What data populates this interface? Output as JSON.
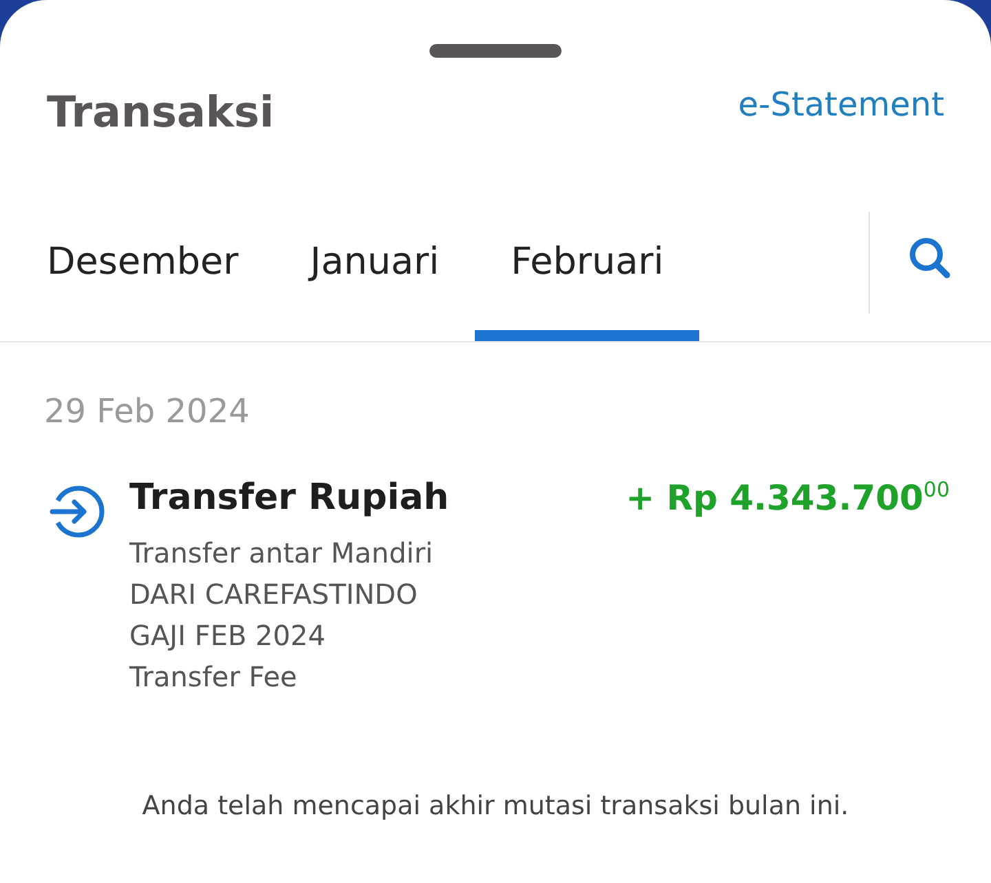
{
  "header": {
    "title": "Transaksi",
    "link": "e-Statement"
  },
  "tabs": [
    {
      "label": "Desember",
      "selected": false
    },
    {
      "label": "Januari",
      "selected": false
    },
    {
      "label": "Februari",
      "selected": true
    }
  ],
  "groups": [
    {
      "date": "29 Feb 2024",
      "transactions": [
        {
          "kind": "incoming",
          "title": "Transfer Rupiah",
          "amount": "+ Rp 4.343.700$^{00}$",
          "details": [
            "Transfer antar Mandiri",
            "DARI CAREFASTINDO",
            "GAJI FEB 2024",
            "Transfer Fee"
          ]
        }
      ]
    }
  ],
  "footer": "Anda telah mencapai akhir mutasi transaksi bulan ini."
}
